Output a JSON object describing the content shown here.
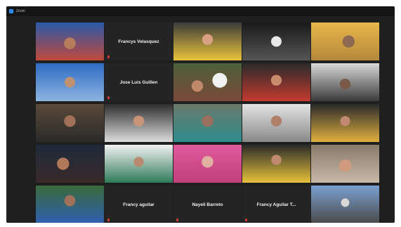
{
  "app": {
    "title": "Zoom",
    "icon": "zoom-app-icon"
  },
  "colors": {
    "active_speaker_border": "#cfd66a",
    "muted_icon": "#d23b3b"
  },
  "tiles": [
    {
      "kind": "video",
      "label": ""
    },
    {
      "kind": "name",
      "name": "Francys Velasquez"
    },
    {
      "kind": "video",
      "label": ""
    },
    {
      "kind": "video",
      "label": ""
    },
    {
      "kind": "video",
      "label": ""
    },
    {
      "kind": "video",
      "label": ""
    },
    {
      "kind": "name",
      "name": "Jose Luis Guillen"
    },
    {
      "kind": "video",
      "label": ""
    },
    {
      "kind": "video",
      "label": ""
    },
    {
      "kind": "video",
      "label": "",
      "active": true
    },
    {
      "kind": "video",
      "label": ""
    },
    {
      "kind": "video",
      "label": ""
    },
    {
      "kind": "video",
      "label": ""
    },
    {
      "kind": "video",
      "label": ""
    },
    {
      "kind": "video",
      "label": ""
    },
    {
      "kind": "video",
      "label": ""
    },
    {
      "kind": "video",
      "label": ""
    },
    {
      "kind": "video",
      "label": ""
    },
    {
      "kind": "video",
      "label": ""
    },
    {
      "kind": "video",
      "label": ""
    },
    {
      "kind": "video",
      "label": ""
    },
    {
      "kind": "name",
      "name": "Francy aguilar"
    },
    {
      "kind": "name",
      "name": "Nayeli Barreto"
    },
    {
      "kind": "name",
      "name": "Francy Aguilar T..."
    },
    {
      "kind": "video",
      "label": ""
    }
  ]
}
